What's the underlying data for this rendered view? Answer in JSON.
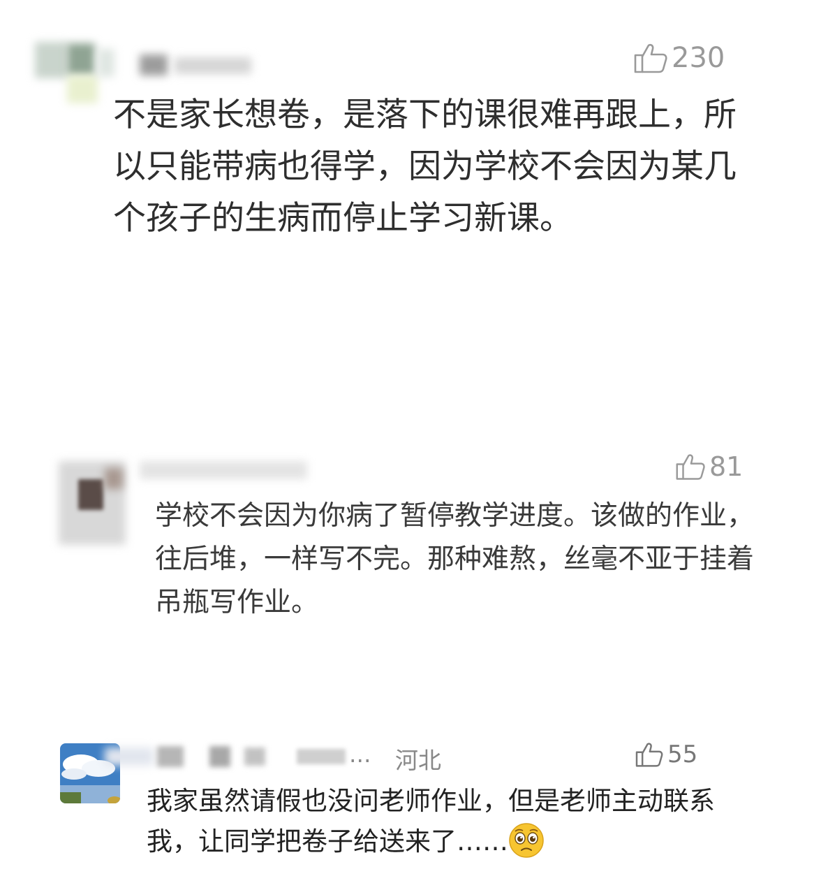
{
  "comments": [
    {
      "likes": "230",
      "text": "不是家长想卷，是落下的课很难再跟上，所以只能带病也得学，因为学校不会因为某几个孩子的生病而停止学习新课。"
    },
    {
      "likes": "81",
      "text": "学校不会因为你病了暂停教学进度。该做的作业，往后堆，一样写不完。那种难熬，丝毫不亚于挂着吊瓶写作业。"
    },
    {
      "likes": "55",
      "username_tail": "...",
      "location": "河北",
      "text": "我家虽然请假也没问老师作业，但是老师主动联系我，让同学把卷子给送来了……",
      "emoji": "pleading-face-icon"
    }
  ],
  "icons": {
    "like": "thumbs-up-outline-icon"
  },
  "colors": {
    "like": "#999999",
    "text": "#333333",
    "emoji": "#f7c531"
  }
}
